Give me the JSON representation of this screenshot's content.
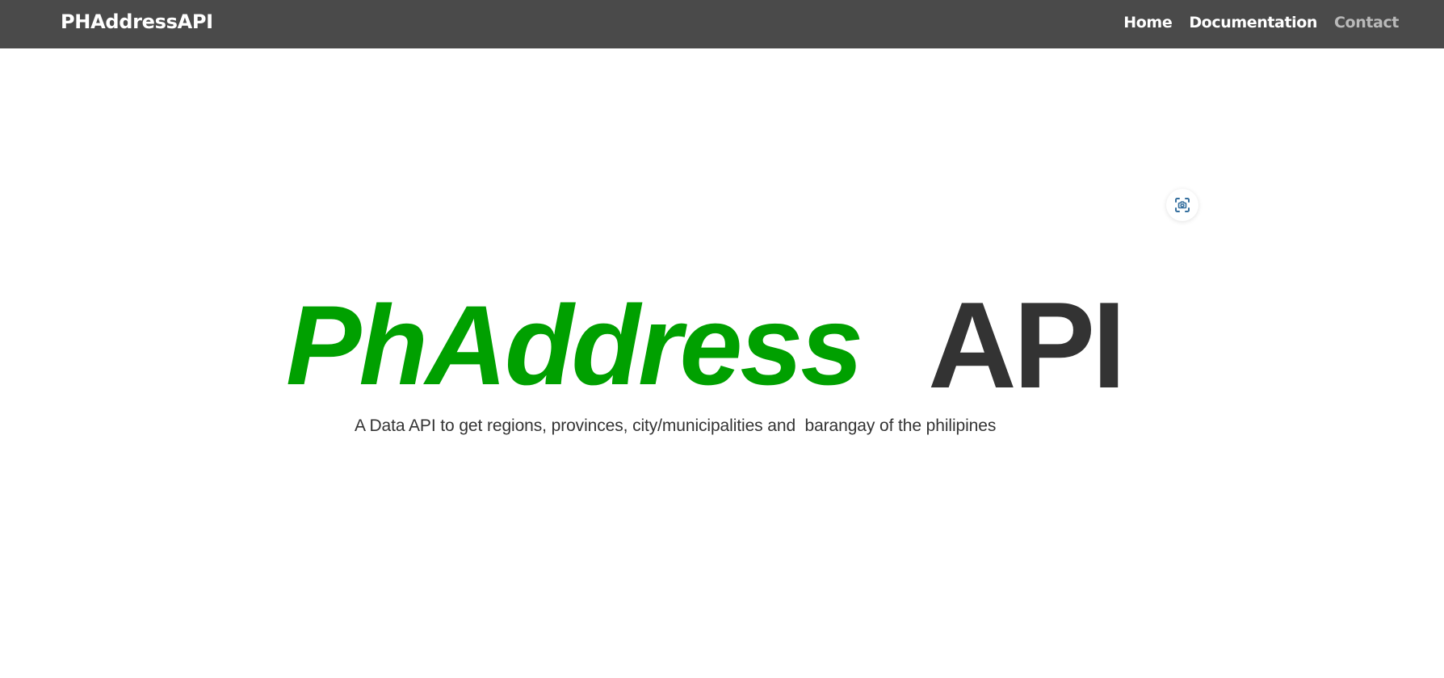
{
  "navbar": {
    "brand": "PHAddressAPI",
    "links": [
      {
        "label": "Home"
      },
      {
        "label": "Documentation"
      },
      {
        "label": "Contact"
      }
    ]
  },
  "hero": {
    "logo_part_green": "PhAddress",
    "logo_part_dark": "API",
    "tagline": "A Data API to get regions, provinces, city/municipalities and  barangay of the philipines"
  },
  "overlay": {
    "visual_search_icon": "visual-search-icon"
  },
  "colors": {
    "navbar_background": "#4a4a4a",
    "logo_green": "#00a000",
    "logo_dark": "#333333",
    "nav_muted": "#b9b9b9"
  }
}
